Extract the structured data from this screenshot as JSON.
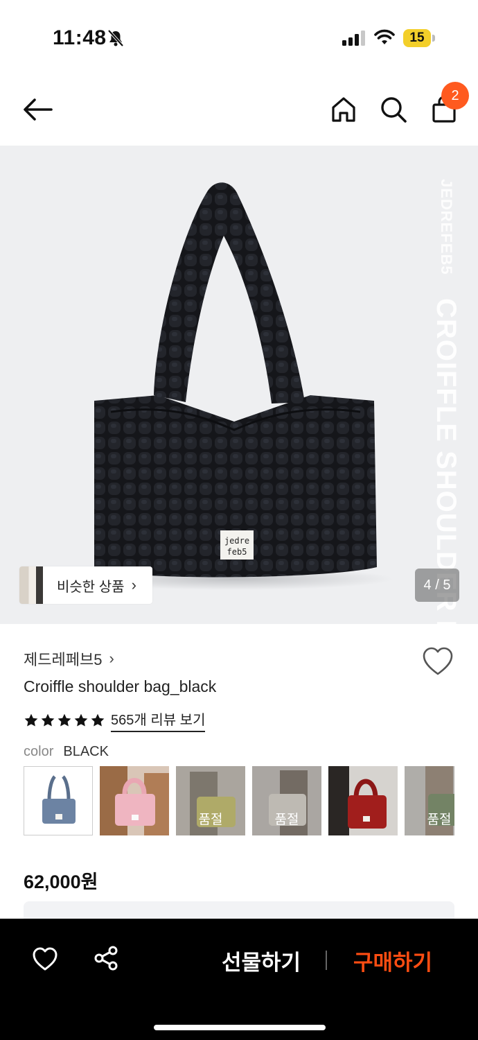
{
  "status_bar": {
    "time": "11:48",
    "battery_level": "15",
    "icons": [
      "bell-off-icon",
      "signal-icon",
      "wifi-icon",
      "battery-icon"
    ]
  },
  "header": {
    "icons": [
      "back-arrow-icon",
      "home-icon",
      "search-icon",
      "shopping-bag-icon"
    ],
    "cart_count": "2"
  },
  "hero": {
    "vertical_brand": "JEDREFEB5",
    "vertical_product": "CROIFFLE SHOULDER BAG BLACK",
    "bag_label_line1": "jedre",
    "bag_label_line2": "feb5",
    "similar_label": "비슷한 상품",
    "similar_chevron": "›",
    "page_indicator": "4 / 5"
  },
  "product": {
    "brand": "제드레페브5",
    "brand_chevron": "›",
    "name": "Croiffle shoulder bag_black",
    "rating_stars": 5,
    "review_link": "565개 리뷰 보기",
    "color_label": "color",
    "color_value": "BLACK",
    "price": "62,000원"
  },
  "color_options": [
    {
      "name": "blue",
      "sold_out": false,
      "selected": true,
      "badge": ""
    },
    {
      "name": "pink",
      "sold_out": false,
      "selected": false,
      "badge": ""
    },
    {
      "name": "yellow",
      "sold_out": true,
      "selected": false,
      "badge": "품절"
    },
    {
      "name": "cream",
      "sold_out": true,
      "selected": false,
      "badge": "품절"
    },
    {
      "name": "red",
      "sold_out": false,
      "selected": false,
      "badge": ""
    },
    {
      "name": "green",
      "sold_out": true,
      "selected": false,
      "badge": "품절"
    }
  ],
  "bottom_bar": {
    "gift_label": "선물하기",
    "buy_label": "구매하기",
    "buy_color": "#ff4d12",
    "badge_color": "#ff5a1f"
  }
}
